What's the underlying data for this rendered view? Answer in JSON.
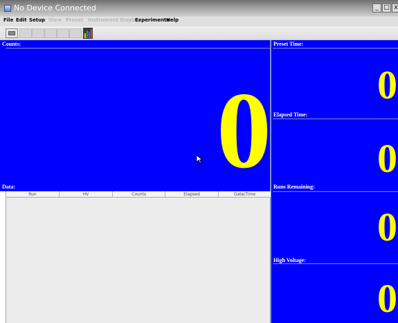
{
  "window": {
    "title": "No Device Connected",
    "controls": {
      "minimize": "_",
      "maximize": "□",
      "close": "x"
    }
  },
  "menubar": {
    "items": [
      {
        "label": "File",
        "enabled": true
      },
      {
        "label": "Edit",
        "enabled": true
      },
      {
        "label": "Setup",
        "enabled": true
      },
      {
        "label": "View",
        "enabled": false
      },
      {
        "label": "Preset",
        "enabled": false
      },
      {
        "label": "Instrument Display",
        "enabled": false
      },
      {
        "label": "Experiments",
        "enabled": true
      },
      {
        "label": "Help",
        "enabled": true
      }
    ]
  },
  "toolbar": {
    "buttons": [
      "open-icon",
      "disabled-button",
      "disabled-button",
      "disabled-button",
      "disabled-button",
      "disabled-button",
      "chart-icon"
    ]
  },
  "panels": {
    "counts": {
      "header": "Counts:",
      "value": "0"
    },
    "preset_time": {
      "header": "Preset Time:",
      "value": "0"
    },
    "elapsed_time": {
      "header": "Elapsed Time:",
      "value": "0"
    },
    "runs_remaining": {
      "header": "Runs Remaining:",
      "value": "0"
    },
    "high_voltage": {
      "header": "High Voltage:",
      "value": "0"
    }
  },
  "data_table": {
    "header": "Data:",
    "columns": [
      "Run",
      "HV",
      "Counts",
      "Elapsed",
      "Date/Time"
    ],
    "rows": []
  },
  "colors": {
    "panel_bg": "#0000ff",
    "value_text": "#ffff00",
    "header_text": "#ffffff",
    "table_bg": "#ececec"
  }
}
